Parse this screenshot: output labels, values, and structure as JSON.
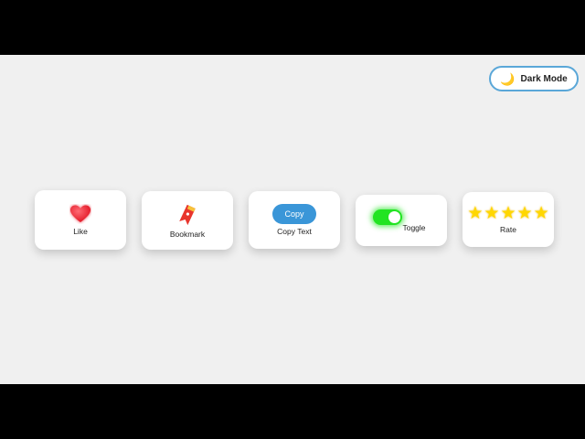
{
  "header": {
    "dark_mode_label": "Dark Mode",
    "moon_glyph": "🌙"
  },
  "cards": {
    "like": {
      "label": "Like",
      "icon": "heart-icon",
      "color": "#ff2b3a"
    },
    "bookmark": {
      "label": "Bookmark",
      "icon": "bookmark-icon",
      "color": "#e8352d"
    },
    "copy": {
      "button_label": "Copy",
      "label": "Copy Text",
      "color": "#3a96d8"
    },
    "toggle": {
      "label": "Toggle",
      "state": "on",
      "color": "#22e422"
    },
    "rate": {
      "label": "Rate",
      "rating": 5,
      "max": 5,
      "star_glyph": "★",
      "color": "#ffd700"
    }
  },
  "colors": {
    "background": "#f0f0f0",
    "card": "#ffffff",
    "border_accent": "#5aa7d8"
  }
}
